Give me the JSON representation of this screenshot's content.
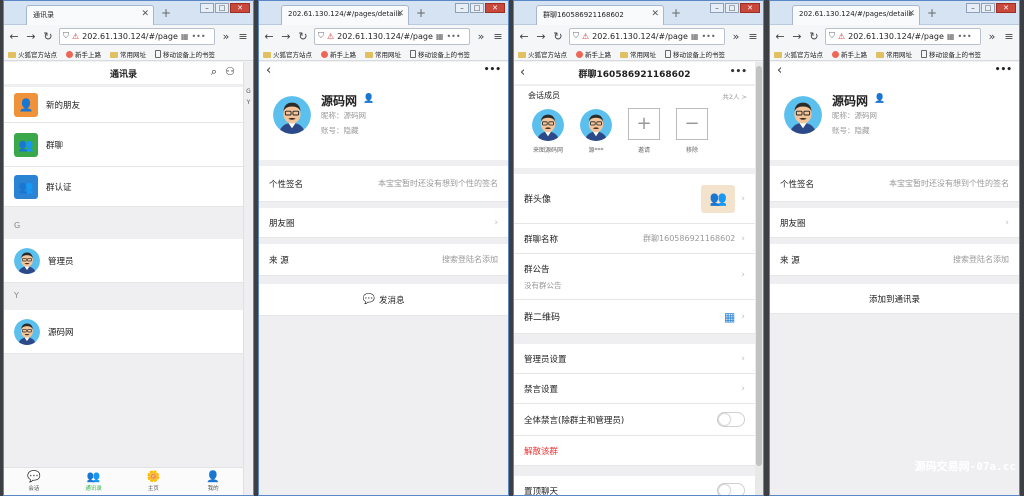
{
  "browser": {
    "tab_titles": [
      "通讯录",
      "202.61.130.124/#/pages/details",
      "群聊160586921168602",
      "202.61.130.124/#/pages/details"
    ],
    "url": "202.61.130.124/#/page",
    "bookmarks": [
      "火狐官方站点",
      "新手上路",
      "常用网址",
      "移动设备上的书签"
    ]
  },
  "contacts": {
    "title": "通讯录",
    "index_letters": [
      "G",
      "Y"
    ],
    "menu": [
      {
        "label": "新的朋友",
        "color": "#f0923a",
        "icon": "👤"
      },
      {
        "label": "群聊",
        "color": "#3aa74a",
        "icon": "👥"
      },
      {
        "label": "群认证",
        "color": "#2b83d4",
        "icon": "👥"
      }
    ],
    "groups": [
      {
        "letter": "G",
        "name": "管理员"
      },
      {
        "letter": "Y",
        "name": "源码网"
      }
    ],
    "tabbar": [
      {
        "label": "会话",
        "icon": "💬"
      },
      {
        "label": "通讯录",
        "icon": "👥"
      },
      {
        "label": "主页",
        "icon": "🌼"
      },
      {
        "label": "我的",
        "icon": "👤"
      }
    ]
  },
  "detail": {
    "name": "源码网",
    "nickname": "昵称：源码网",
    "account": "账号：隐藏",
    "signature_label": "个性签名",
    "signature_value": "本宝宝暂时还没有想到个性的签名",
    "moments_label": "朋友圈",
    "source_label": "来 源",
    "source_value": "搜索登陆名添加",
    "send_message": "发消息",
    "add_contact": "添加到通讯录"
  },
  "group": {
    "title": "群聊160586921168602",
    "members_label": "会话成员",
    "members_count": "共2人 >",
    "members": [
      "来图源码网",
      "源***"
    ],
    "invite_label": "邀请",
    "remove_label": "移除",
    "avatar_label": "群头像",
    "name_label": "群聊名称",
    "name_value": "群聊160586921168602",
    "notice_label": "群公告",
    "notice_value": "没有群公告",
    "qrcode_label": "群二维码",
    "admin_label": "管理员设置",
    "mute_label": "禁言设置",
    "mute_all_label": "全体禁言(除群主和管理员)",
    "dissolve_label": "解散该群",
    "pin_label": "置顶聊天"
  },
  "watermark": "源码交易网-07a.cc",
  "colors": {
    "accent_green": "#3bb54a",
    "danger": "#e33",
    "link_blue": "#2b83d4"
  }
}
